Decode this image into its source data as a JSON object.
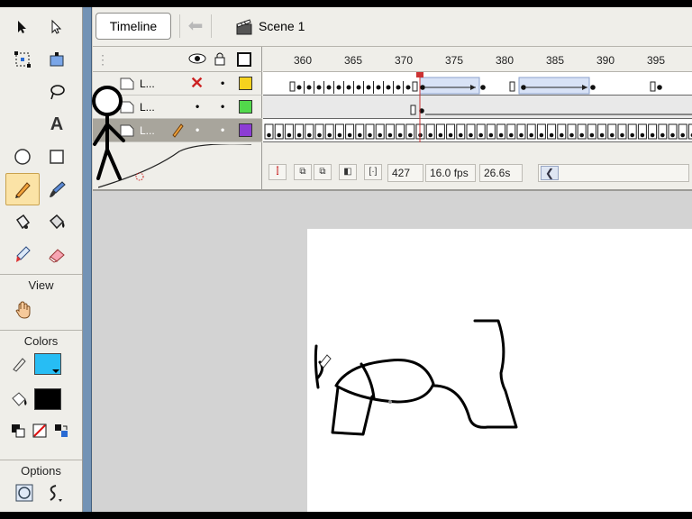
{
  "timeline": {
    "tab_label": "Timeline",
    "scene_label": "Scene 1",
    "ruler_ticks": [
      "360",
      "365",
      "370",
      "375",
      "380",
      "385",
      "390",
      "395"
    ],
    "layers": [
      {
        "name": "L...",
        "visible": "hidden",
        "locked": "•",
        "color": "#f5d21e"
      },
      {
        "name": "L...",
        "visible": "•",
        "locked": "•",
        "color": "#52d94b"
      },
      {
        "name": "L...",
        "visible": "•",
        "locked": "•",
        "color": "#8c3dd4"
      }
    ],
    "current_frame": "427",
    "fps": "16.0 fps",
    "elapsed": "26.6s"
  },
  "tools": {
    "view_label": "View",
    "colors_label": "Colors",
    "options_label": "Options",
    "stroke_color": "#27bdf4",
    "fill_color": "#000000"
  },
  "stage": {
    "background": "#ffffff"
  }
}
